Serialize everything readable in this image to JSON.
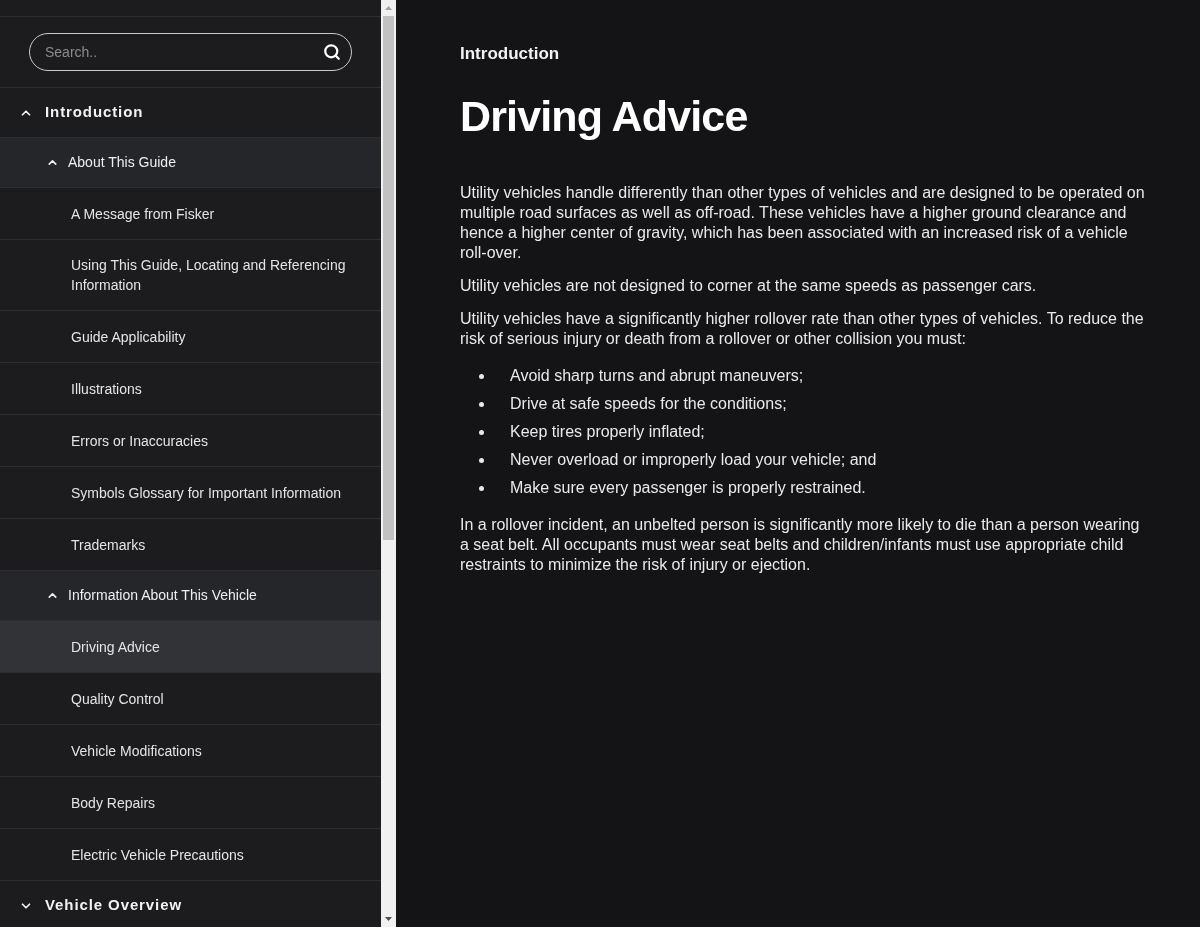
{
  "sidebar": {
    "search": {
      "placeholder": "Search.."
    },
    "nav": [
      {
        "label": "Introduction",
        "expanded": true,
        "children": [
          {
            "label": "About This Guide",
            "expanded": true,
            "children": [
              {
                "label": "A Message from Fisker",
                "selected": false
              },
              {
                "label": "Using This Guide, Locating and Referencing Information",
                "selected": false
              },
              {
                "label": "Guide Applicability",
                "selected": false
              },
              {
                "label": "Illustrations",
                "selected": false
              },
              {
                "label": "Errors or Inaccuracies",
                "selected": false
              },
              {
                "label": "Symbols Glossary for Important Information",
                "selected": false
              },
              {
                "label": "Trademarks",
                "selected": false
              }
            ]
          },
          {
            "label": "Information About This Vehicle",
            "expanded": true,
            "children": [
              {
                "label": "Driving Advice",
                "selected": true
              },
              {
                "label": "Quality Control",
                "selected": false
              },
              {
                "label": "Vehicle Modifications",
                "selected": false
              },
              {
                "label": "Body Repairs",
                "selected": false
              },
              {
                "label": "Electric Vehicle Precautions",
                "selected": false
              }
            ]
          }
        ]
      },
      {
        "label": "Vehicle Overview",
        "expanded": false
      }
    ]
  },
  "content": {
    "breadcrumb": "Introduction",
    "title": "Driving Advice",
    "blocks": [
      {
        "kind": "paragraph",
        "text": "Utility vehicles handle differently than other types of vehicles and are designed to be operated on multiple road surfaces as well as off-road. These vehicles have a higher ground clearance and hence a higher center of gravity, which has been associated with an increased risk of a vehicle roll-over."
      },
      {
        "kind": "paragraph",
        "text": "Utility vehicles are not designed to corner at the same speeds as passenger cars."
      },
      {
        "kind": "paragraph",
        "text": "Utility vehicles have a significantly higher rollover rate than other types of vehicles. To reduce the risk of serious injury or death from a rollover or other collision you must:"
      },
      {
        "kind": "bullets",
        "items": [
          "Avoid sharp turns and abrupt maneuvers;",
          "Drive at safe speeds for the conditions;",
          "Keep tires properly inflated;",
          "Never overload or improperly load your vehicle; and",
          "Make sure every passenger is properly restrained."
        ]
      },
      {
        "kind": "paragraph",
        "text": "In a rollover incident, an unbelted person is significantly more likely to die than a person wearing a seat belt. All occupants must wear seat belts and children/infants must use appropriate child restraints to minimize the risk of injury or ejection."
      }
    ]
  }
}
